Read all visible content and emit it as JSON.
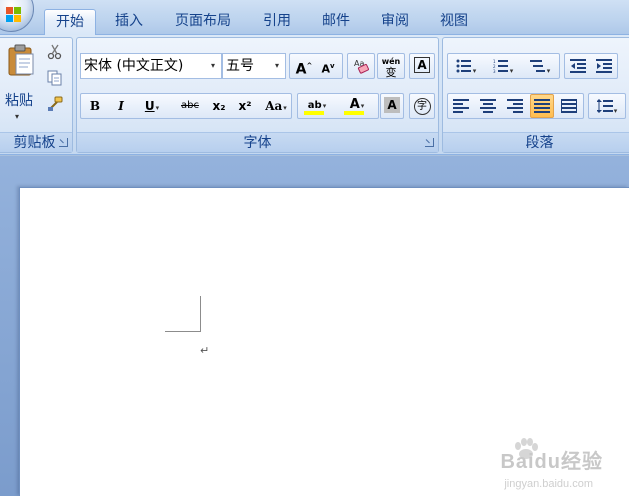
{
  "tabs": [
    {
      "label": "开始",
      "active": true
    },
    {
      "label": "插入"
    },
    {
      "label": "页面布局"
    },
    {
      "label": "引用"
    },
    {
      "label": "邮件"
    },
    {
      "label": "审阅"
    },
    {
      "label": "视图"
    }
  ],
  "clipboard": {
    "paste_label": "粘贴",
    "group_label": "剪贴板",
    "cut_icon": "scissors-icon",
    "copy_icon": "copy-icon",
    "format_painter_icon": "brush-icon"
  },
  "font": {
    "group_label": "字体",
    "font_name": "宋体 (中文正文)",
    "font_size": "五号",
    "grow_font": "A",
    "shrink_font": "A",
    "clear_format_icon": "eraser-icon",
    "phonetic_label": "wén",
    "phonetic_char": "变",
    "char_border": "A",
    "bold": "B",
    "italic": "I",
    "underline": "U",
    "strikethrough": "abc",
    "subscript": "x₂",
    "superscript": "x²",
    "change_case": "Aa",
    "highlight": "ab",
    "font_color": "A",
    "char_shading": "A",
    "enclose_char": "字",
    "highlight_color": "#ffff00",
    "font_color_value": "#ffff00"
  },
  "paragraph": {
    "group_label": "段落",
    "bullets_icon": "bullet-list-icon",
    "numbering_icon": "numbered-list-icon",
    "multilevel_icon": "multilevel-list-icon",
    "decrease_indent_icon": "decrease-indent-icon",
    "increase_indent_icon": "increase-indent-icon",
    "align_left_icon": "align-left-icon",
    "align_center_icon": "align-center-icon",
    "align_right_icon": "align-right-icon",
    "justify_icon": "justify-icon",
    "distributed_icon": "distributed-icon",
    "line_spacing_icon": "line-spacing-icon",
    "active_alignment": "justify"
  },
  "document": {
    "paragraph_mark": "↵"
  },
  "watermark": {
    "brand": "Baidu经验",
    "url": "jingyan.baidu.com"
  }
}
